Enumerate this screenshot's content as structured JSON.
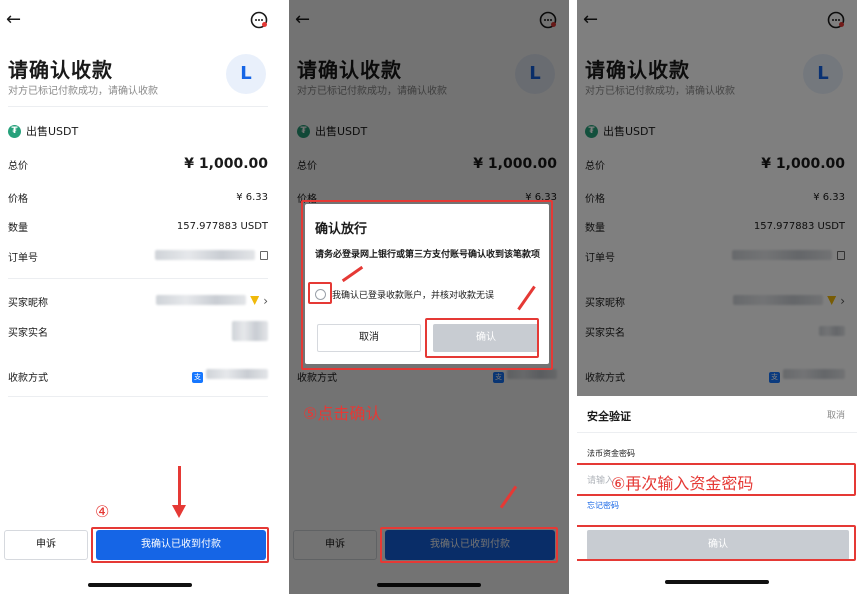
{
  "panels": [
    {
      "title": "请确认收款",
      "subtitle": "对方已标记付款成功，请确认收款",
      "avatar_letter": "L",
      "sell_label": "出售USDT",
      "rows": {
        "total_label": "总价",
        "total_value": "¥ 1,000.00",
        "price_label": "价格",
        "price_value": "¥ 6.33",
        "qty_label": "数量",
        "qty_value": "157.977883 USDT",
        "order_label": "订单号",
        "nick_label": "买家昵称",
        "realname_label": "买家实名",
        "paymethod_label": "收款方式"
      },
      "appeal_label": "申诉",
      "confirm_label": "我确认已收到付款",
      "step_label": "④"
    },
    {
      "dialog": {
        "title": "确认放行",
        "text": "请务必登录网上银行或第三方支付账号确认收到该笔款项",
        "check_label": "我确认已登录收款账户，并核对收款无误",
        "cancel_label": "取消",
        "ok_label": "确认"
      },
      "step_label": "⑤点击确认"
    },
    {
      "sheet": {
        "title": "安全验证",
        "cancel_label": "取消",
        "pwd_label": "法币资金密码",
        "pwd_placeholder": "请输入",
        "forgot_label": "忘记密码",
        "ok_label": "确认"
      },
      "step_label": "⑥再次输入资金密码"
    }
  ],
  "icons": {
    "back": "back-arrow-icon",
    "message": "message-icon",
    "tether": "tether-icon",
    "copy": "copy-icon",
    "chevron": "chevron-right-icon",
    "pay": "alipay-icon"
  },
  "colors": {
    "accent": "#1565e6",
    "annotation": "#e53935",
    "tether": "#26a17b"
  },
  "glyphs": {
    "back": "←",
    "chevron": "›",
    "tether": "₮",
    "pay": "支"
  }
}
